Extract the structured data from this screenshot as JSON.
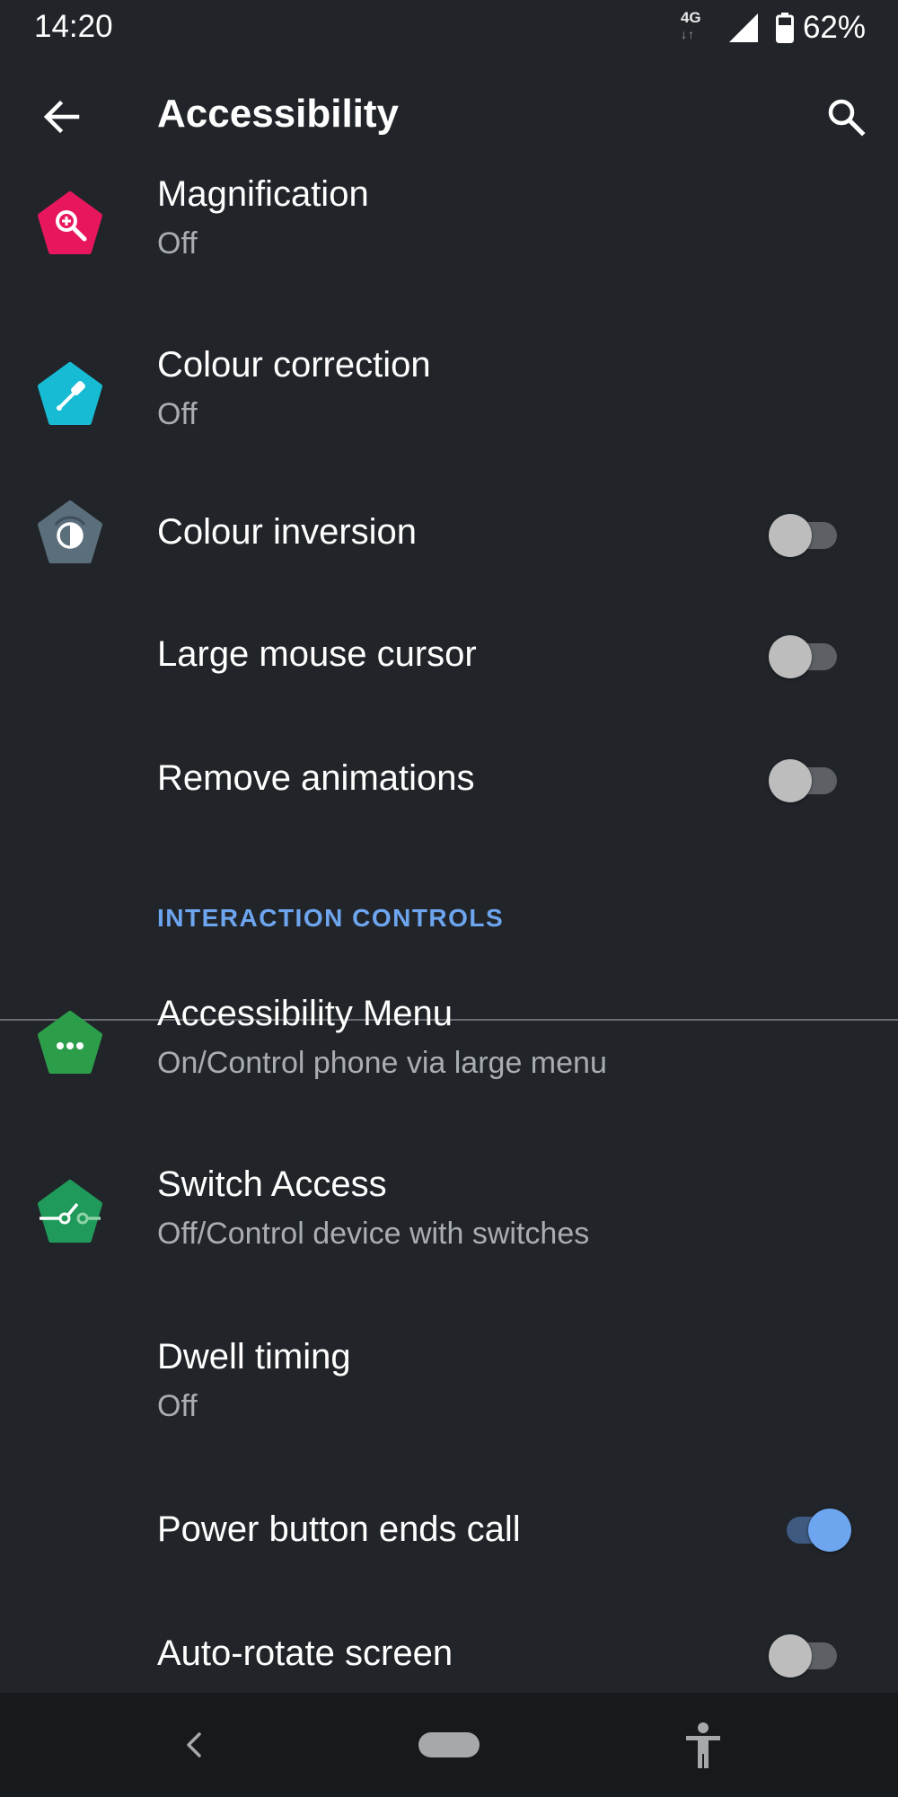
{
  "status_bar": {
    "time": "14:20",
    "network_type": "4G",
    "network_arrows": "↓↑",
    "battery_percent": "62%",
    "battery_level": 0.62
  },
  "app_bar": {
    "back_icon": "arrow-left-icon",
    "title": "Accessibility",
    "search_icon": "search-icon"
  },
  "items": [
    {
      "title": "Magnification",
      "summary": "Off",
      "icon": "magnification-icon",
      "icon_color": "#e8175d"
    },
    {
      "title": "Colour correction",
      "summary": "Off",
      "icon": "eyedropper-icon",
      "icon_color": "#17bcd4"
    },
    {
      "title": "Colour inversion",
      "icon": "colour-inversion-icon",
      "icon_color": "#5b6e7b",
      "toggle_on": false
    },
    {
      "title": "Large mouse cursor",
      "toggle_on": false
    },
    {
      "title": "Remove animations",
      "toggle_on": false
    }
  ],
  "section": {
    "header": "INTERACTION CONTROLS"
  },
  "interaction_items": [
    {
      "title": "Accessibility Menu",
      "summary": "On/Control phone via large menu",
      "icon": "accessibility-menu-icon",
      "icon_color": "#2c9e4a"
    },
    {
      "title": "Switch Access",
      "summary": "Off/Control device with switches",
      "icon": "switch-access-icon",
      "icon_color": "#1f9a5a"
    },
    {
      "title": "Dwell timing",
      "summary": "Off"
    },
    {
      "title": "Power button ends call",
      "toggle_on": true
    },
    {
      "title": "Auto-rotate screen",
      "toggle_on": false
    }
  ],
  "colors": {
    "background": "#21252a",
    "accent": "#6ea5ef",
    "summary_text": "#a9adb2",
    "nav_bar": "#171a1d"
  },
  "nav_bar": {
    "back_icon": "nav-back-icon",
    "home_icon": "home-pill-icon",
    "accessibility_icon": "accessibility-person-icon"
  }
}
